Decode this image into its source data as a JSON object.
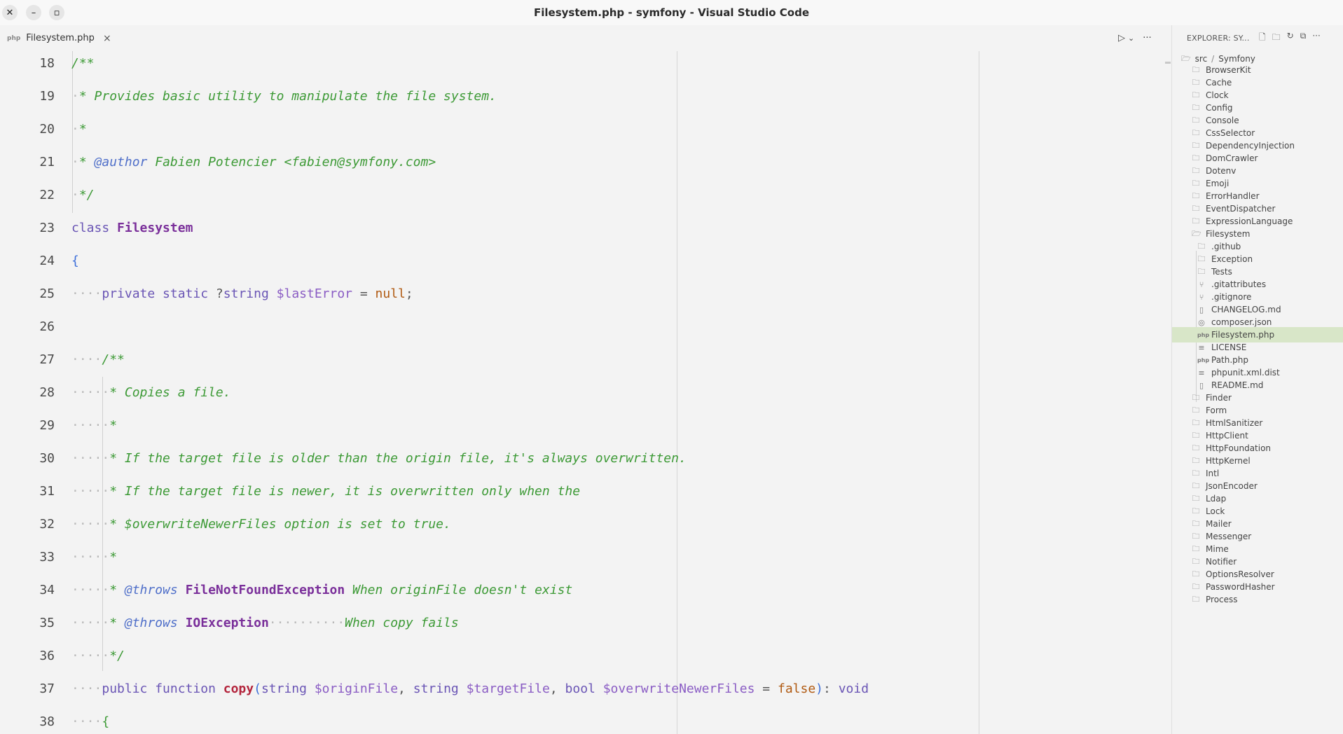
{
  "window": {
    "title": "Filesystem.php - symfony - Visual Studio Code",
    "controls": {
      "close": "✕",
      "minimize": "–",
      "maximize": "▫"
    }
  },
  "tabs": [
    {
      "label": "Filesystem.php",
      "type": "php",
      "close": "×"
    }
  ],
  "editor_actions": {
    "run": "▷",
    "dropdown": "⌄",
    "more": "···"
  },
  "explorer": {
    "title": "EXPLORER: SY...",
    "actions": [
      "new-file-icon",
      "new-folder-icon",
      "refresh-icon",
      "collapse-all-icon",
      "more-icon"
    ],
    "breadcrumb": [
      "src",
      "Symfony"
    ],
    "items": [
      {
        "label": "BrowserKit",
        "kind": "folder",
        "depth": 1
      },
      {
        "label": "Cache",
        "kind": "folder",
        "depth": 1
      },
      {
        "label": "Clock",
        "kind": "folder",
        "depth": 1
      },
      {
        "label": "Config",
        "kind": "folder",
        "depth": 1
      },
      {
        "label": "Console",
        "kind": "folder",
        "depth": 1
      },
      {
        "label": "CssSelector",
        "kind": "folder",
        "depth": 1
      },
      {
        "label": "DependencyInjection",
        "kind": "folder",
        "depth": 1
      },
      {
        "label": "DomCrawler",
        "kind": "folder",
        "depth": 1
      },
      {
        "label": "Dotenv",
        "kind": "folder",
        "depth": 1
      },
      {
        "label": "Emoji",
        "kind": "folder",
        "depth": 1
      },
      {
        "label": "ErrorHandler",
        "kind": "folder",
        "depth": 1
      },
      {
        "label": "EventDispatcher",
        "kind": "folder",
        "depth": 1
      },
      {
        "label": "ExpressionLanguage",
        "kind": "folder",
        "depth": 1
      },
      {
        "label": "Filesystem",
        "kind": "folder-open",
        "depth": 1
      },
      {
        "label": ".github",
        "kind": "folder",
        "depth": 2
      },
      {
        "label": "Exception",
        "kind": "folder",
        "depth": 2
      },
      {
        "label": "Tests",
        "kind": "folder",
        "depth": 2
      },
      {
        "label": ".gitattributes",
        "kind": "git",
        "depth": 2
      },
      {
        "label": ".gitignore",
        "kind": "git",
        "depth": 2
      },
      {
        "label": "CHANGELOG.md",
        "kind": "book",
        "depth": 2
      },
      {
        "label": "composer.json",
        "kind": "db",
        "depth": 2
      },
      {
        "label": "Filesystem.php",
        "kind": "php",
        "depth": 2,
        "selected": true
      },
      {
        "label": "LICENSE",
        "kind": "text",
        "depth": 2
      },
      {
        "label": "Path.php",
        "kind": "php",
        "depth": 2
      },
      {
        "label": "phpunit.xml.dist",
        "kind": "text",
        "depth": 2
      },
      {
        "label": "README.md",
        "kind": "book",
        "depth": 2
      },
      {
        "label": "Finder",
        "kind": "folder",
        "depth": 1
      },
      {
        "label": "Form",
        "kind": "folder",
        "depth": 1
      },
      {
        "label": "HtmlSanitizer",
        "kind": "folder",
        "depth": 1
      },
      {
        "label": "HttpClient",
        "kind": "folder",
        "depth": 1
      },
      {
        "label": "HttpFoundation",
        "kind": "folder",
        "depth": 1
      },
      {
        "label": "HttpKernel",
        "kind": "folder",
        "depth": 1
      },
      {
        "label": "Intl",
        "kind": "folder",
        "depth": 1
      },
      {
        "label": "JsonEncoder",
        "kind": "folder",
        "depth": 1
      },
      {
        "label": "Ldap",
        "kind": "folder",
        "depth": 1
      },
      {
        "label": "Lock",
        "kind": "folder",
        "depth": 1
      },
      {
        "label": "Mailer",
        "kind": "folder",
        "depth": 1
      },
      {
        "label": "Messenger",
        "kind": "folder",
        "depth": 1
      },
      {
        "label": "Mime",
        "kind": "folder",
        "depth": 1
      },
      {
        "label": "Notifier",
        "kind": "folder",
        "depth": 1
      },
      {
        "label": "OptionsResolver",
        "kind": "folder",
        "depth": 1
      },
      {
        "label": "PasswordHasher",
        "kind": "folder",
        "depth": 1
      },
      {
        "label": "Process",
        "kind": "folder",
        "depth": 1
      }
    ]
  },
  "code_lines": [
    {
      "n": "18",
      "tokens": [
        [
          "c",
          "/**"
        ]
      ]
    },
    {
      "n": "19",
      "tokens": [
        [
          "ws",
          "·"
        ],
        [
          "c",
          "* Provides basic utility to manipulate the file system."
        ]
      ]
    },
    {
      "n": "20",
      "tokens": [
        [
          "ws",
          "·"
        ],
        [
          "c",
          "*"
        ]
      ]
    },
    {
      "n": "21",
      "tokens": [
        [
          "ws",
          "·"
        ],
        [
          "c",
          "* "
        ],
        [
          "tag",
          "@author"
        ],
        [
          "c",
          " Fabien Potencier <fabien@symfony.com>"
        ]
      ]
    },
    {
      "n": "22",
      "tokens": [
        [
          "ws",
          "·"
        ],
        [
          "c",
          "*/"
        ]
      ]
    },
    {
      "n": "23",
      "tokens": [
        [
          "kw",
          "class "
        ],
        [
          "cls",
          "Filesystem"
        ]
      ]
    },
    {
      "n": "24",
      "tokens": [
        [
          "brace",
          "{"
        ]
      ]
    },
    {
      "n": "25",
      "tokens": [
        [
          "ws",
          "····"
        ],
        [
          "kw",
          "private static "
        ],
        [
          "op",
          "?"
        ],
        [
          "type",
          "string"
        ],
        [
          "op",
          " "
        ],
        [
          "var",
          "$lastError"
        ],
        [
          "op",
          " = "
        ],
        [
          "val",
          "null"
        ],
        [
          "op",
          ";"
        ]
      ]
    },
    {
      "n": "26",
      "tokens": []
    },
    {
      "n": "27",
      "tokens": [
        [
          "ws",
          "····"
        ],
        [
          "c",
          "/**"
        ]
      ]
    },
    {
      "n": "28",
      "tokens": [
        [
          "ws",
          "·····"
        ],
        [
          "c",
          "* Copies a file."
        ]
      ]
    },
    {
      "n": "29",
      "tokens": [
        [
          "ws",
          "·····"
        ],
        [
          "c",
          "*"
        ]
      ]
    },
    {
      "n": "30",
      "tokens": [
        [
          "ws",
          "·····"
        ],
        [
          "c",
          "* If the target file is older than the origin file, it's always overwritten."
        ]
      ]
    },
    {
      "n": "31",
      "tokens": [
        [
          "ws",
          "·····"
        ],
        [
          "c",
          "* If the target file is newer, it is overwritten only when the"
        ]
      ]
    },
    {
      "n": "32",
      "tokens": [
        [
          "ws",
          "·····"
        ],
        [
          "c",
          "* $overwriteNewerFiles option is set to true."
        ]
      ]
    },
    {
      "n": "33",
      "tokens": [
        [
          "ws",
          "·····"
        ],
        [
          "c",
          "*"
        ]
      ]
    },
    {
      "n": "34",
      "tokens": [
        [
          "ws",
          "·····"
        ],
        [
          "c",
          "* "
        ],
        [
          "tag",
          "@throws"
        ],
        [
          "c",
          " "
        ],
        [
          "cls",
          "FileNotFoundException"
        ],
        [
          "c",
          " When originFile doesn't exist"
        ]
      ]
    },
    {
      "n": "35",
      "tokens": [
        [
          "ws",
          "·····"
        ],
        [
          "c",
          "* "
        ],
        [
          "tag",
          "@throws"
        ],
        [
          "c",
          " "
        ],
        [
          "cls",
          "IOException"
        ],
        [
          "ws",
          "··········"
        ],
        [
          "c",
          "When copy fails"
        ]
      ]
    },
    {
      "n": "36",
      "tokens": [
        [
          "ws",
          "·····"
        ],
        [
          "c",
          "*/"
        ]
      ]
    },
    {
      "n": "37",
      "tokens": [
        [
          "ws",
          "····"
        ],
        [
          "kw",
          "public function "
        ],
        [
          "fn",
          "copy"
        ],
        [
          "brace",
          "("
        ],
        [
          "type",
          "string"
        ],
        [
          "op",
          " "
        ],
        [
          "var",
          "$originFile"
        ],
        [
          "op",
          ", "
        ],
        [
          "type",
          "string"
        ],
        [
          "op",
          " "
        ],
        [
          "var",
          "$targetFile"
        ],
        [
          "op",
          ", "
        ],
        [
          "type",
          "bool"
        ],
        [
          "op",
          " "
        ],
        [
          "var",
          "$overwriteNewerFiles"
        ],
        [
          "op",
          " = "
        ],
        [
          "val",
          "false"
        ],
        [
          "brace",
          ")"
        ],
        [
          "op",
          ": "
        ],
        [
          "type",
          "void"
        ]
      ]
    },
    {
      "n": "38",
      "tokens": [
        [
          "ws",
          "····"
        ],
        [
          "cb",
          "{"
        ]
      ]
    }
  ]
}
